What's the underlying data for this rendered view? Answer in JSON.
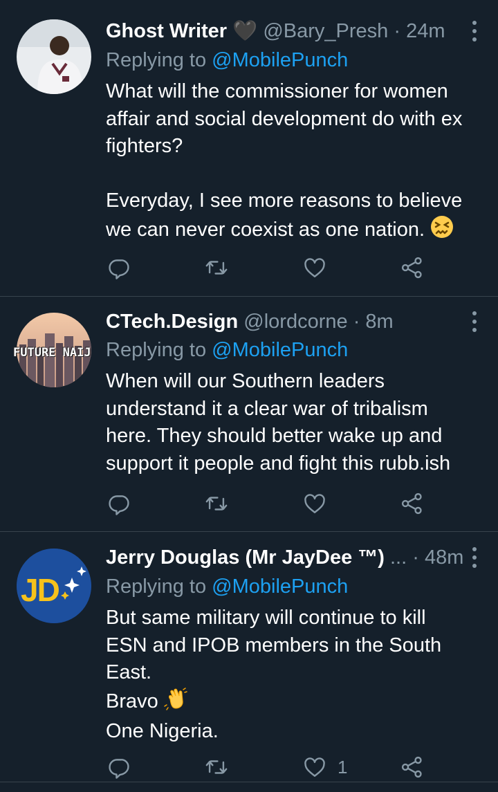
{
  "tweets": [
    {
      "name": "Ghost Writer",
      "name_suffix": "🖤",
      "handle": "@Bary_Presh",
      "sep": "·",
      "time": "24m",
      "replying_prefix": "Replying to ",
      "replying_to": "@MobilePunch",
      "lines": [
        "What will the commissioner for women",
        "affair and social development do with ex",
        "fighters?",
        "",
        "Everyday, I see more reasons to believe",
        "we can never coexist as one nation."
      ],
      "like_count": ""
    },
    {
      "name": "CTech.Design",
      "handle": "@lordcorne",
      "sep": "·",
      "time": "8m",
      "avatar_text": "FUTURE NAIJ",
      "replying_prefix": "Replying to ",
      "replying_to": "@MobilePunch",
      "lines": [
        "When will our Southern leaders",
        "understand it a clear war of tribalism",
        "here. They should better wake up and",
        "support it people and fight this rubb.ish"
      ],
      "like_count": ""
    },
    {
      "name": "Jerry Douglas (Mr JayDee ™)",
      "ellipsis": "...",
      "sep": "·",
      "time": "48m",
      "avatar_text": "JD",
      "replying_prefix": "Replying to ",
      "replying_to": "@MobilePunch",
      "lines": [
        "But same military will continue to kill",
        "ESN and IPOB members in the South",
        "East.",
        "Bravo",
        "One Nigeria."
      ],
      "like_count": "1"
    }
  ],
  "colors": {
    "background": "#15202b",
    "divider": "#38444d",
    "secondary_text": "#8899a6",
    "mention": "#1da1f2"
  },
  "icons": [
    "reply-icon",
    "retweet-icon",
    "like-icon",
    "share-icon",
    "more-icon"
  ]
}
